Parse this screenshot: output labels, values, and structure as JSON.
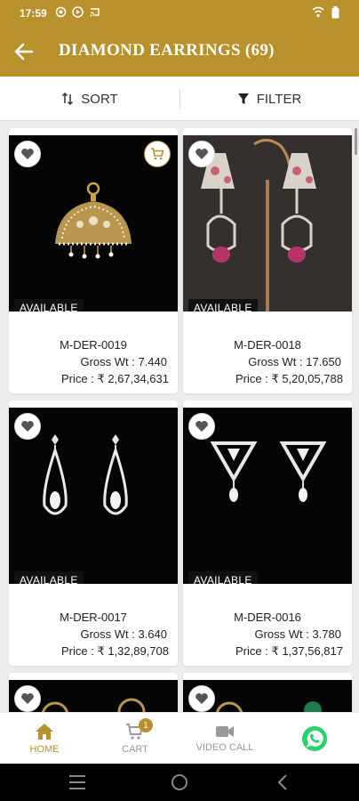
{
  "status_bar": {
    "time": "17:59"
  },
  "header": {
    "title": "DIAMOND EARRINGS (69)"
  },
  "toolbar": {
    "sort_label": "SORT",
    "filter_label": "FILTER"
  },
  "products": [
    {
      "code": "M-DER-0019",
      "gross_wt": "Gross Wt : 7.440",
      "price": "Price : ₹ 2,67,34,631",
      "status": "AVAILABLE"
    },
    {
      "code": "M-DER-0018",
      "gross_wt": "Gross Wt : 17.650",
      "price": "Price : ₹ 5,20,05,788",
      "status": "AVAILABLE"
    },
    {
      "code": "M-DER-0017",
      "gross_wt": "Gross Wt : 3.640",
      "price": "Price : ₹ 1,32,89,708",
      "status": "AVAILABLE"
    },
    {
      "code": "M-DER-0016",
      "gross_wt": "Gross Wt : 3.780",
      "price": "Price : ₹ 1,37,56,817",
      "status": "AVAILABLE"
    }
  ],
  "bottom_nav": {
    "home": "HOME",
    "cart": "CART",
    "cart_count": "1",
    "video_call": "VIDEO CALL"
  },
  "colors": {
    "accent": "#b8902c",
    "whatsapp": "#25d366"
  }
}
